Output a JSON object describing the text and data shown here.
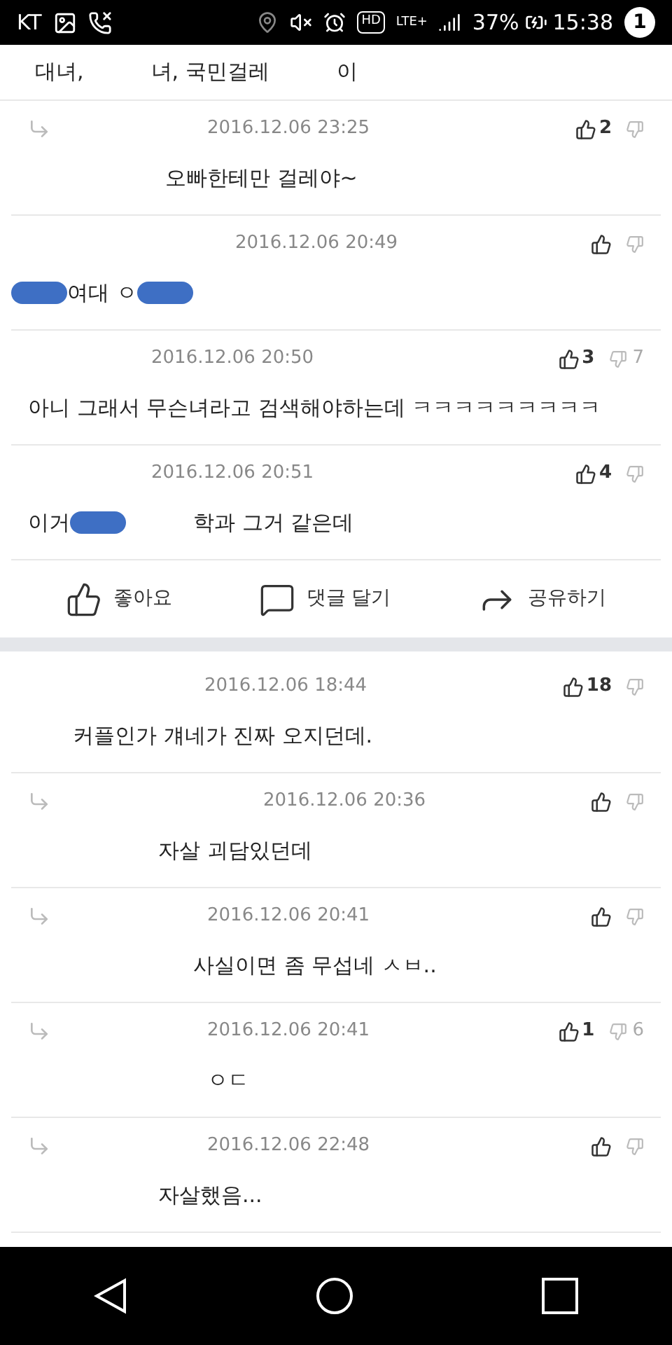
{
  "status_bar": {
    "carrier": "KT",
    "hd": "HD",
    "network": "LTE+",
    "battery": "37%",
    "time": "15:38",
    "badge": "1"
  },
  "top_text": [
    {
      "kind": "text",
      "text": "대녀,"
    },
    {
      "kind": "gap"
    },
    {
      "kind": "text",
      "text": "녀, 국민걸레"
    },
    {
      "kind": "gap"
    },
    {
      "kind": "text",
      "text": "이"
    }
  ],
  "post_1_comments": [
    {
      "reply": true,
      "date": "2016.12.06 23:25",
      "likes": "2",
      "parts": [
        {
          "kind": "text",
          "text": "오빠한테만 걸레야~"
        }
      ]
    },
    {
      "reply": false,
      "date": "2016.12.06 20:49",
      "parts": [
        {
          "kind": "blot"
        },
        {
          "kind": "text",
          "text": "여대 ㅇ"
        },
        {
          "kind": "blot"
        }
      ]
    },
    {
      "reply": false,
      "date": "2016.12.06 20:50",
      "likes": "3",
      "dislikes": "7",
      "parts": [
        {
          "kind": "text",
          "text": "아니 그래서 무슨녀라고 검색해야하는데 ㅋㅋㅋㅋㅋㅋㅋㅋㅋ"
        }
      ]
    },
    {
      "reply": false,
      "date": "2016.12.06 20:51",
      "likes": "4",
      "parts": [
        {
          "kind": "text",
          "text": "이거"
        },
        {
          "kind": "blot"
        },
        {
          "kind": "gap"
        },
        {
          "kind": "text",
          "text": "학과 그거 같은데"
        }
      ]
    }
  ],
  "actions": [
    "좋아요",
    "댓글 달기",
    "공유하기"
  ],
  "post_2_comments": [
    {
      "reply": false,
      "date": "2016.12.06 18:44",
      "likes": "18",
      "parts": [
        {
          "kind": "text",
          "text": "커플인가 걔네가 진짜 오지던데."
        }
      ]
    },
    {
      "reply": true,
      "date": "2016.12.06 20:36",
      "parts": [
        {
          "kind": "text",
          "text": "자살 괴담있던데"
        }
      ]
    },
    {
      "reply": true,
      "date": "2016.12.06 20:41",
      "parts": [
        {
          "kind": "text",
          "text": "사실이면 좀 무섭네 ㅅㅂ.."
        }
      ]
    },
    {
      "reply": true,
      "date": "2016.12.06 20:41",
      "likes": "1",
      "dislikes": "6",
      "parts": [
        {
          "kind": "text",
          "text": "ㅇㄷ"
        }
      ]
    },
    {
      "reply": true,
      "date": "2016.12.06 22:48",
      "parts": [
        {
          "kind": "text",
          "text": "자살했음..."
        }
      ]
    }
  ]
}
